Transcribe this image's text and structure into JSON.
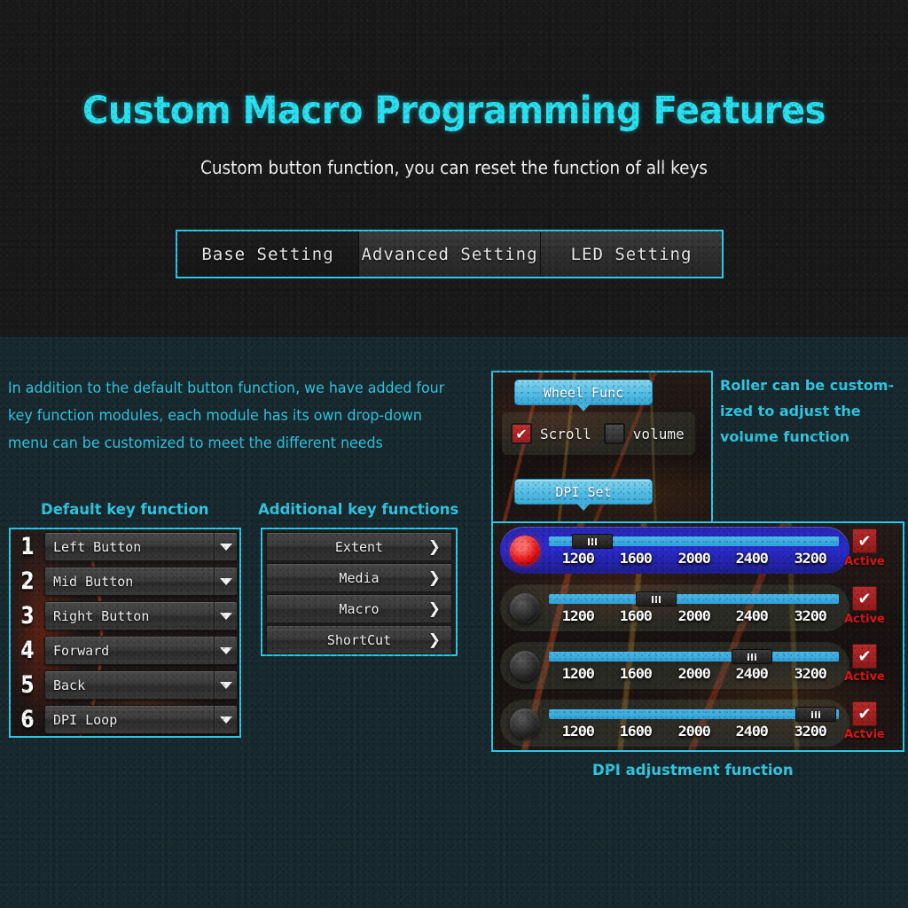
{
  "hero": {
    "title": "Custom Macro Programming Features",
    "subtitle": "Custom button function, you can reset the function of all keys"
  },
  "tabs": [
    {
      "label": "Base Setting",
      "active": true
    },
    {
      "label": "Advanced Setting",
      "active": false
    },
    {
      "label": "LED Setting",
      "active": false
    }
  ],
  "intro_paragraph": "In addition to the default button function, we have added  four key function modules, each  module  has  its  own  drop-down menu can be customized to meet the different needs",
  "roller_note": "Roller can be custom-ized to adjust the volume function",
  "dpi_caption": "DPI adjustment function",
  "default_keys": {
    "caption": "Default key function",
    "rows": [
      {
        "num": "1",
        "label": "Left Button"
      },
      {
        "num": "2",
        "label": "Mid Button"
      },
      {
        "num": "3",
        "label": "Right Button"
      },
      {
        "num": "4",
        "label": "Forward"
      },
      {
        "num": "5",
        "label": "Back"
      },
      {
        "num": "6",
        "label": "DPI Loop"
      }
    ]
  },
  "additional_keys": {
    "caption": "Additional key functions",
    "rows": [
      {
        "label": "Extent",
        "chevron": "❯"
      },
      {
        "label": "Media",
        "chevron": "❯"
      },
      {
        "label": "Macro",
        "chevron": "❯"
      },
      {
        "label": "ShortCut",
        "chevron": "❯"
      }
    ]
  },
  "wheel_func": {
    "header": "Wheel Func",
    "dpi_header": "DPI Set",
    "options": [
      {
        "label": "Scroll",
        "checked": true,
        "mark": "✔"
      },
      {
        "label": "volume",
        "checked": false,
        "mark": ""
      }
    ]
  },
  "dpi_rows": [
    {
      "selected": true,
      "led_on": true,
      "handle_pct": 8,
      "active_label": "Active",
      "check": "✔"
    },
    {
      "selected": false,
      "led_on": false,
      "handle_pct": 30,
      "active_label": "Active",
      "check": "✔"
    },
    {
      "selected": false,
      "led_on": false,
      "handle_pct": 63,
      "active_label": "Active",
      "check": "✔"
    },
    {
      "selected": false,
      "led_on": false,
      "handle_pct": 85,
      "active_label": "Actvie",
      "check": "✔"
    }
  ],
  "dpi_ticks": [
    "1200",
    "1600",
    "2000",
    "2400",
    "3200"
  ],
  "colors": {
    "accent_cyan": "#28c8e8",
    "title_cyan": "#27e0f0",
    "text_cyan": "#2fc6e0",
    "selected_blue": "#2a2ad0",
    "active_red": "#e01414",
    "slider_blue": "#3aabdf",
    "hero_bg": "#181818",
    "lower_bg": "#17282e"
  }
}
